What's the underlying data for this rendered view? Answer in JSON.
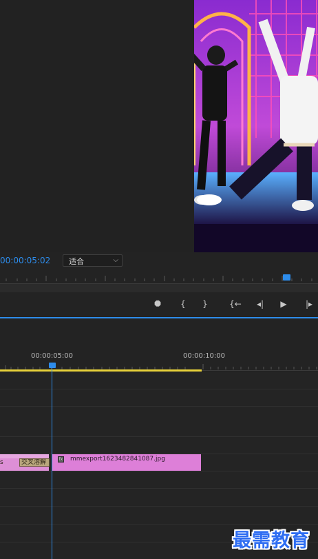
{
  "program_monitor": {
    "timecode": "00:00:05:02",
    "fit_select": {
      "value": "适合"
    }
  },
  "transport": {
    "buttons": [
      {
        "name": "add-marker-icon",
        "glyph": "⯃"
      },
      {
        "name": "mark-in-icon",
        "glyph": "{"
      },
      {
        "name": "mark-out-icon",
        "glyph": "}"
      },
      {
        "name": "go-to-in-icon",
        "glyph": "{←"
      },
      {
        "name": "step-back-icon",
        "glyph": "◂|"
      },
      {
        "name": "play-icon",
        "glyph": "▶"
      },
      {
        "name": "step-forward-icon",
        "glyph": "|▸"
      }
    ]
  },
  "timeline": {
    "ruler_labels": [
      "00:00:05:00",
      "00:00:10:00"
    ],
    "clips": [
      {
        "transition_label": "交叉溶解",
        "left_label": "s"
      },
      {
        "name": "mmexport1623482841087.jpg"
      }
    ]
  },
  "colors": {
    "accent": "#2d8ceb",
    "work_area": "#e8d23a",
    "clip": "#dd7fd8",
    "transition": "#b9a77c"
  },
  "watermark": "最需教育"
}
